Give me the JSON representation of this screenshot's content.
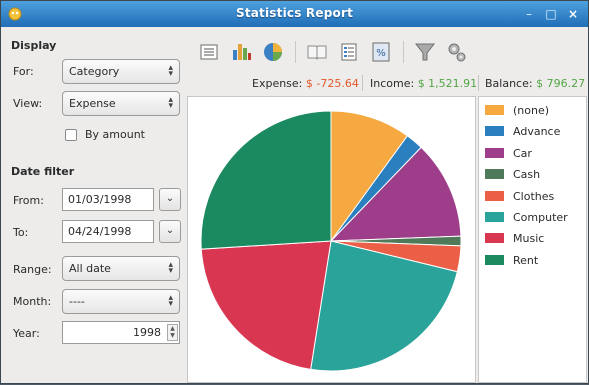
{
  "window": {
    "title": "Statistics Report"
  },
  "sidebar": {
    "display_title": "Display",
    "for_label": "For:",
    "for_value": "Category",
    "view_label": "View:",
    "view_value": "Expense",
    "by_amount_label": "By amount",
    "date_filter_title": "Date filter",
    "from_label": "From:",
    "from_value": "01/03/1998",
    "to_label": "To:",
    "to_value": "04/24/1998",
    "range_label": "Range:",
    "range_value": "All date",
    "month_label": "Month:",
    "month_value": "----",
    "year_label": "Year:",
    "year_value": "1998"
  },
  "summary": {
    "expense_label": "Expense:",
    "expense_value": "$ -725.64",
    "income_label": "Income:",
    "income_value": "$ 1,521.91",
    "balance_label": "Balance:",
    "balance_value": "$ 796.27"
  },
  "chart_data": {
    "type": "pie",
    "title": "",
    "series": [
      {
        "name": "(none)",
        "value": 10.0,
        "color": "#f5a940"
      },
      {
        "name": "Advance",
        "value": 2.2,
        "color": "#2a7fbf"
      },
      {
        "name": "Car",
        "value": 12.2,
        "color": "#9e3d8a"
      },
      {
        "name": "Cash",
        "value": 1.2,
        "color": "#4f7a5a"
      },
      {
        "name": "Clothes",
        "value": 3.2,
        "color": "#ea5f46"
      },
      {
        "name": "Computer",
        "value": 23.7,
        "color": "#2aa39a"
      },
      {
        "name": "Music",
        "value": 21.5,
        "color": "#d93651"
      },
      {
        "name": "Rent",
        "value": 26.0,
        "color": "#1b8a60"
      }
    ]
  }
}
